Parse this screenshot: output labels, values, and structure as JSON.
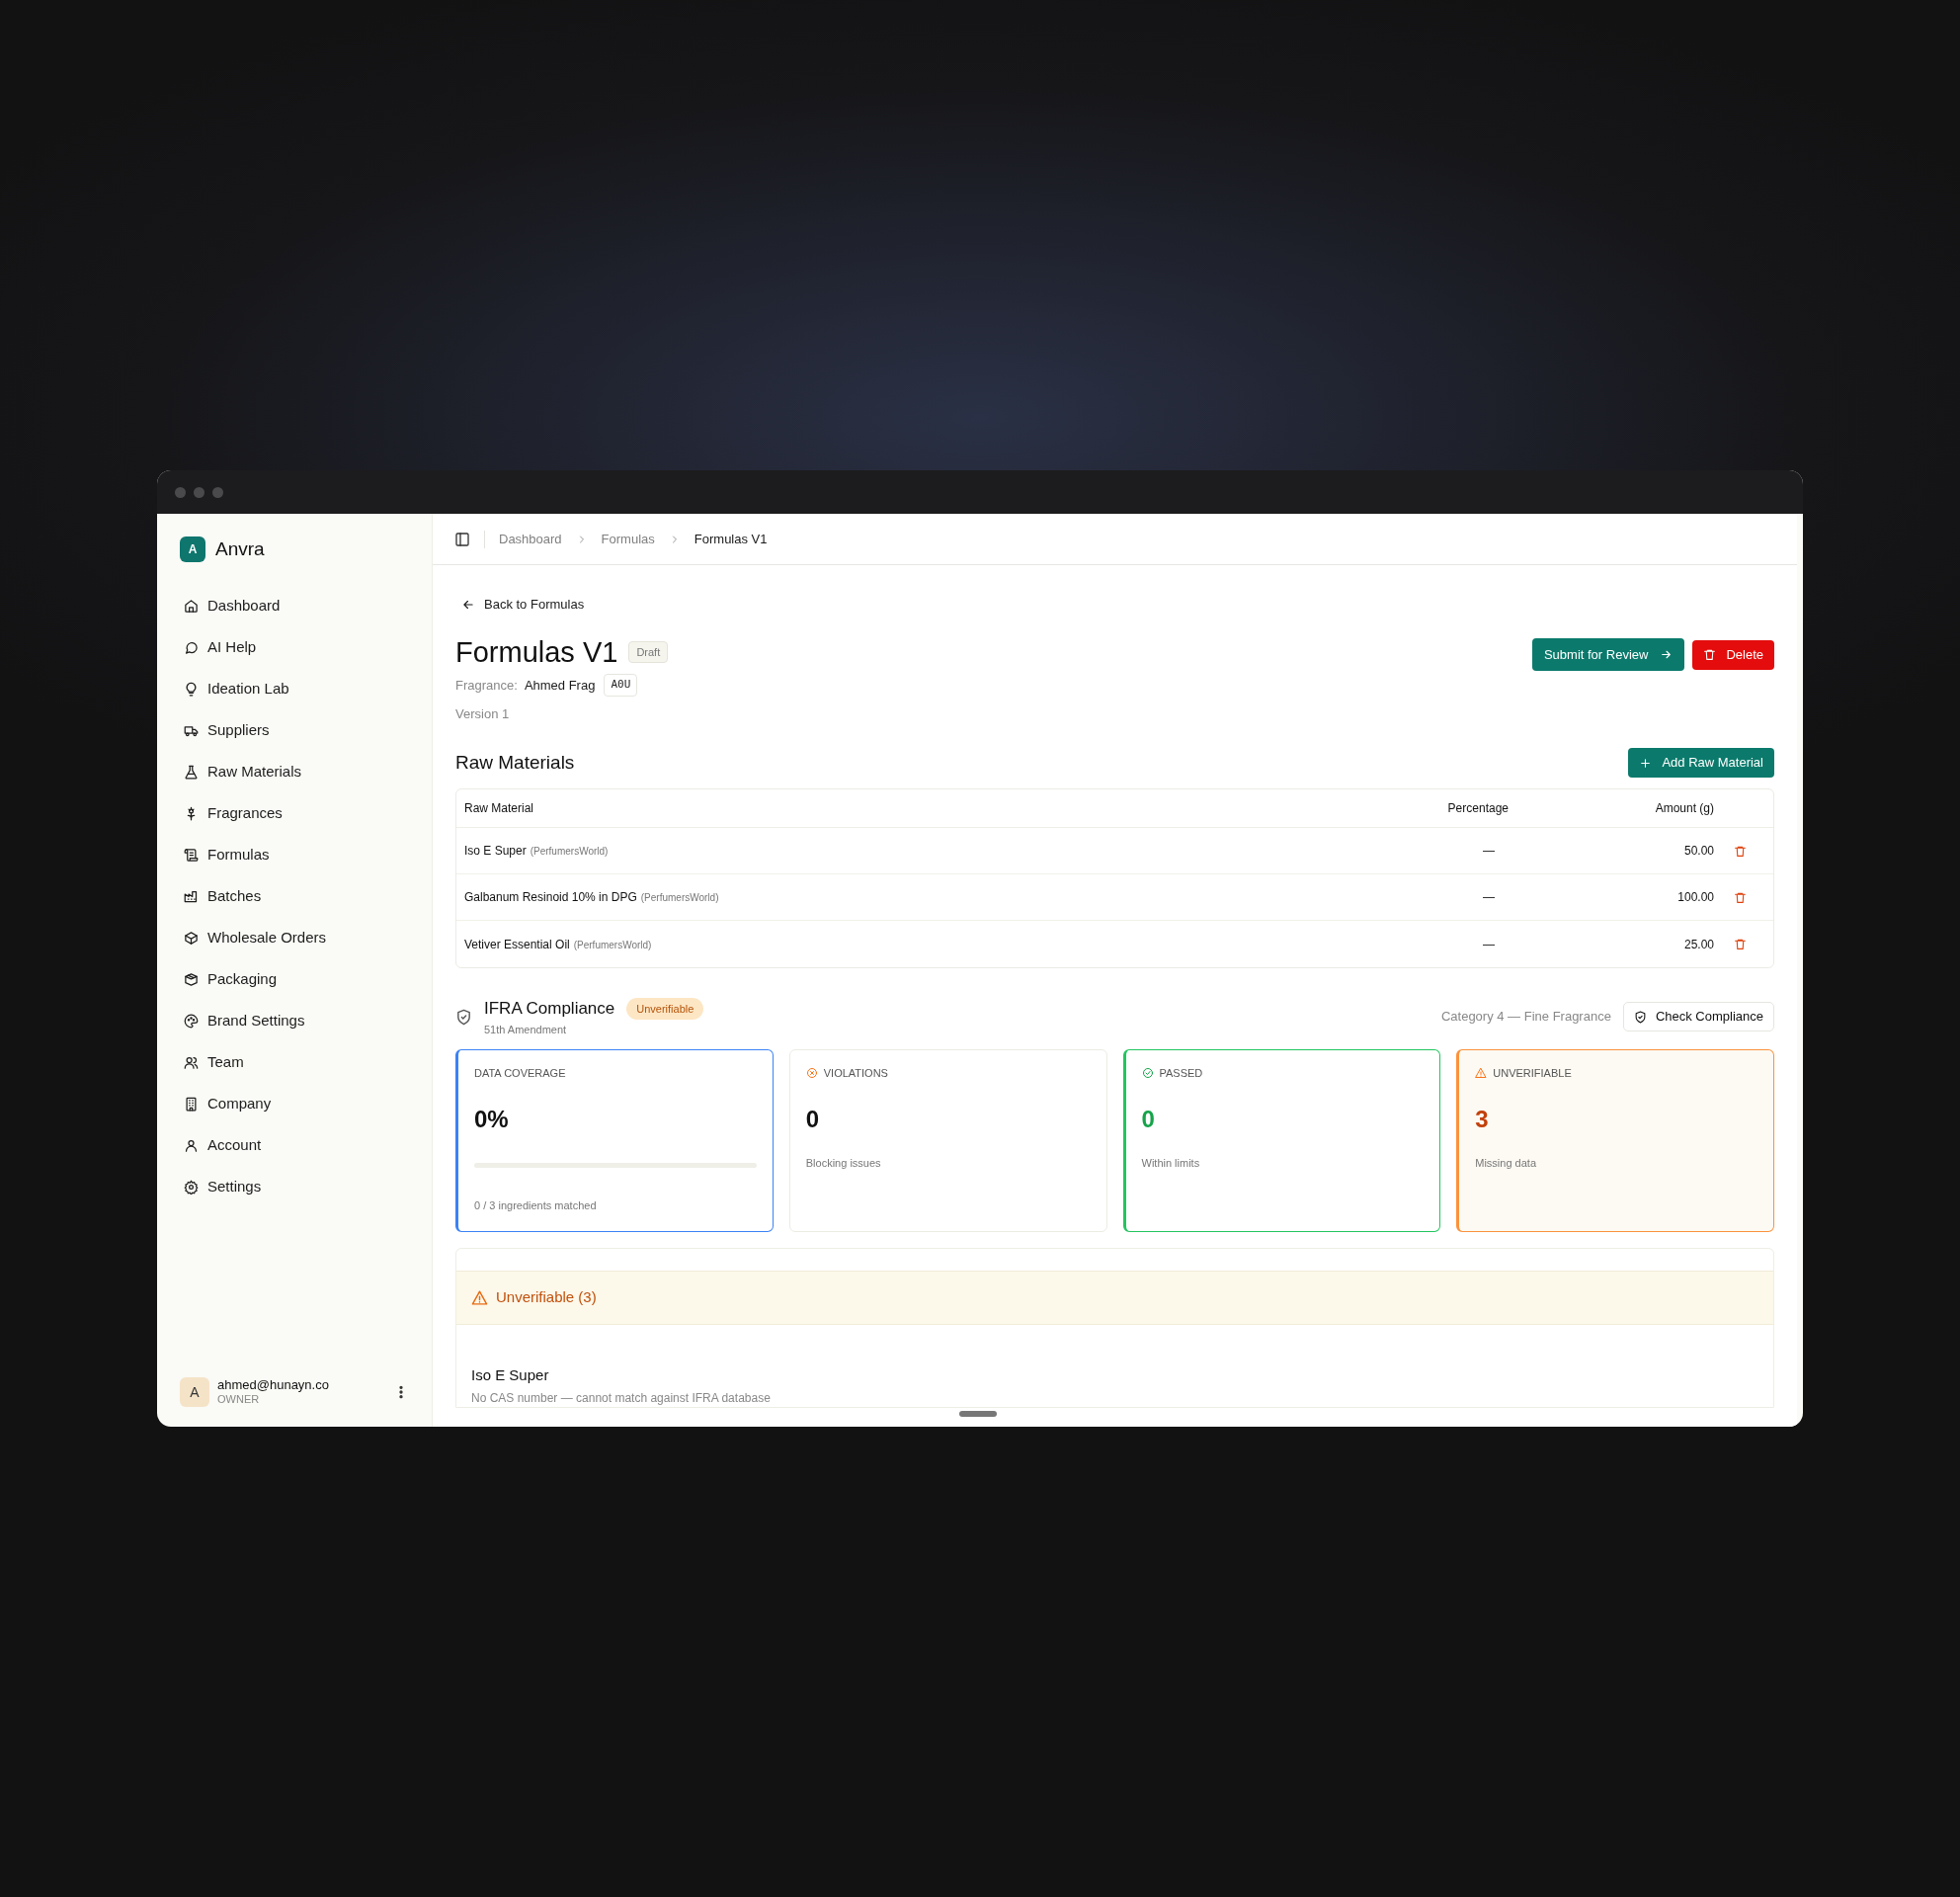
{
  "sidebar": {
    "logo_letter": "A",
    "brand": "Anvra",
    "items": [
      {
        "label": "Dashboard"
      },
      {
        "label": "AI Help"
      },
      {
        "label": "Ideation Lab"
      },
      {
        "label": "Suppliers"
      },
      {
        "label": "Raw Materials"
      },
      {
        "label": "Fragrances"
      },
      {
        "label": "Formulas"
      },
      {
        "label": "Batches"
      },
      {
        "label": "Wholesale Orders"
      },
      {
        "label": "Packaging"
      },
      {
        "label": "Brand Settings"
      },
      {
        "label": "Team"
      },
      {
        "label": "Company"
      },
      {
        "label": "Account"
      },
      {
        "label": "Settings"
      }
    ],
    "user": {
      "avatar": "A",
      "email": "ahmed@hunayn.co",
      "role": "OWNER"
    }
  },
  "breadcrumb": [
    "Dashboard",
    "Formulas",
    "Formulas V1"
  ],
  "back_link": "Back to Formulas",
  "header": {
    "title": "Formulas V1",
    "status": "Draft",
    "fragrance_label": "Fragrance:",
    "fragrance_name": "Ahmed Frag",
    "fragrance_code": "A0U",
    "version": "Version 1",
    "submit_button": "Submit for Review",
    "delete_button": "Delete"
  },
  "raw_materials": {
    "title": "Raw Materials",
    "add_button": "Add Raw Material",
    "columns": [
      "Raw Material",
      "Percentage",
      "Amount (g)"
    ],
    "rows": [
      {
        "name": "Iso E Super",
        "supplier": "(PerfumersWorld)",
        "percentage": "—",
        "amount": "50.00"
      },
      {
        "name": "Galbanum Resinoid 10% in DPG",
        "supplier": "(PerfumersWorld)",
        "percentage": "—",
        "amount": "100.00"
      },
      {
        "name": "Vetiver Essential Oil",
        "supplier": "(PerfumersWorld)",
        "percentage": "—",
        "amount": "25.00"
      }
    ]
  },
  "compliance": {
    "title": "IFRA Compliance",
    "subtitle": "51th Amendment",
    "badge": "Unverifiable",
    "category": "Category 4 — Fine Fragrance",
    "check_button": "Check Compliance",
    "cards": [
      {
        "kind": "coverage",
        "label": "DATA COVERAGE",
        "value": "0%",
        "level": 0,
        "caption": "0 / 3 ingredients matched"
      },
      {
        "kind": "violations",
        "label": "VIOLATIONS",
        "value": "0",
        "caption": "Blocking issues"
      },
      {
        "kind": "passed",
        "label": "PASSED",
        "value": "0",
        "caption": "Within limits"
      },
      {
        "kind": "unverifiable",
        "label": "UNVERIFIABLE",
        "value": "3",
        "caption": "Missing data"
      }
    ],
    "unverifiable_panel": {
      "title": "Unverifiable (3)",
      "items": [
        {
          "name": "Iso E Super",
          "reason": "No CAS number — cannot match against IFRA database"
        }
      ]
    }
  }
}
